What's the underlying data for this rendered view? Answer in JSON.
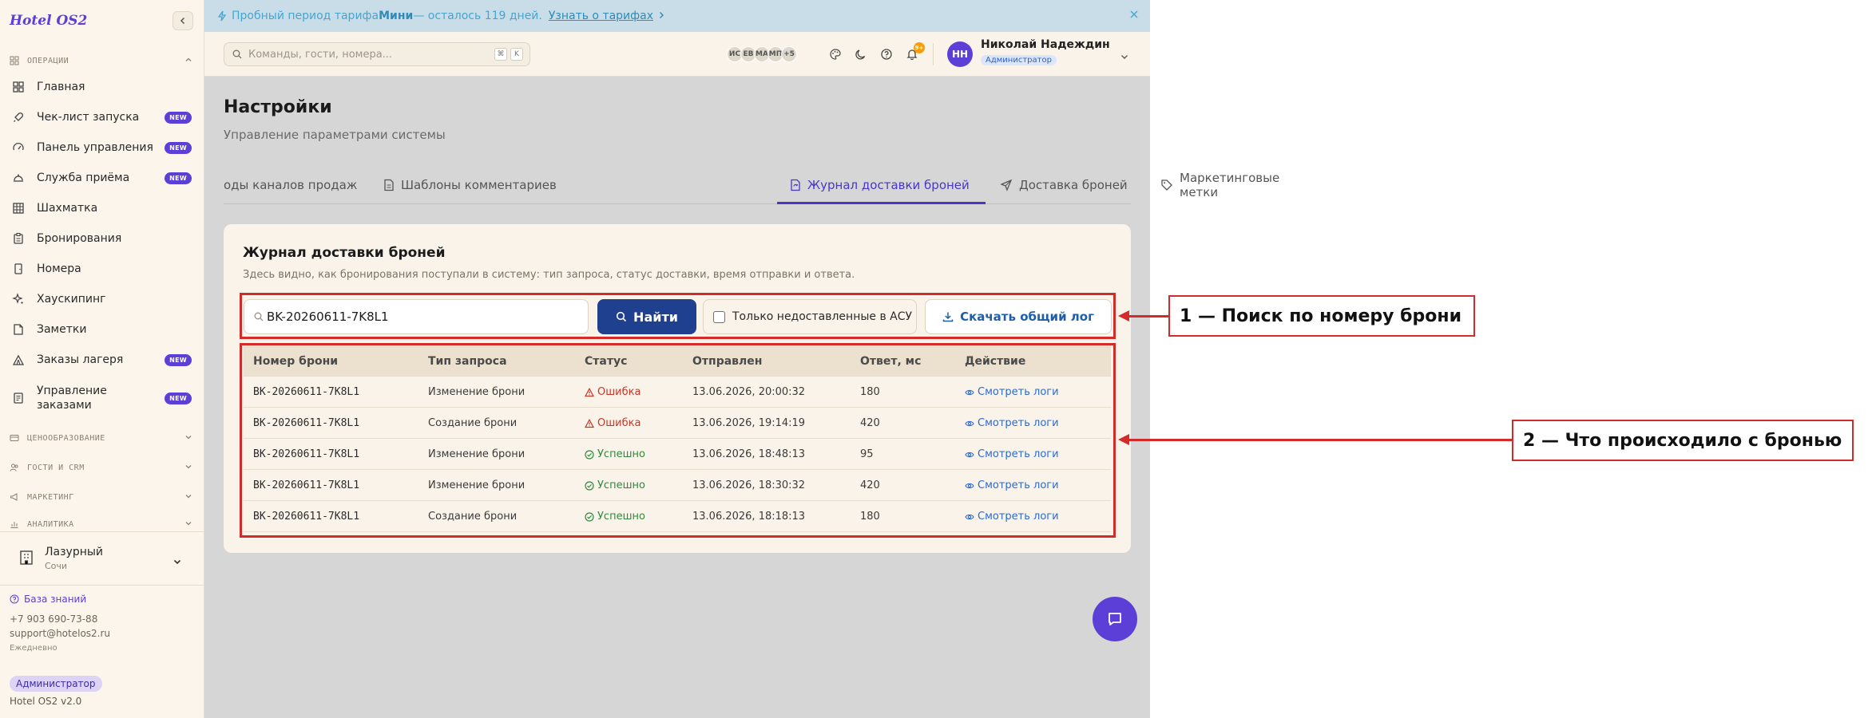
{
  "sidebar": {
    "brand": "Hotel OS2",
    "sections": {
      "operations": "ОПЕРАЦИИ",
      "pricing": "ЦЕНООБРАЗОВАНИЕ",
      "guests": "ГОСТИ И CRM",
      "marketing": "МАРКЕТИНГ",
      "analytics": "АНАЛИТИКА"
    },
    "items": [
      {
        "label": "Главная",
        "badge": ""
      },
      {
        "label": "Чек-лист запуска",
        "badge": "NEW"
      },
      {
        "label": "Панель управления",
        "badge": "NEW"
      },
      {
        "label": "Служба приёма",
        "badge": "NEW"
      },
      {
        "label": "Шахматка",
        "badge": ""
      },
      {
        "label": "Бронирования",
        "badge": ""
      },
      {
        "label": "Номера",
        "badge": ""
      },
      {
        "label": "Хаускипинг",
        "badge": ""
      },
      {
        "label": "Заметки",
        "badge": ""
      },
      {
        "label": "Заказы лагеря",
        "badge": "NEW"
      },
      {
        "label": "Управление заказами",
        "badge": "NEW"
      }
    ],
    "hotel": {
      "name": "Лазурный",
      "city": "Сочи"
    },
    "footer": {
      "kb_label": "База знаний",
      "phone": "+7 903 690-73-88",
      "email": "support@hotelos2.ru",
      "schedule": "Ежедневно",
      "role": "Администратор",
      "version": "Hotel OS2 v2.0"
    }
  },
  "trial_banner": {
    "prefix": "Пробный период тарифа ",
    "plan": "Мини",
    "suffix": " — осталось 119 дней.",
    "link": "Узнать о тарифах"
  },
  "header": {
    "search_placeholder": "Команды, гости, номера...",
    "shortcut_keys": [
      "⌘",
      "K"
    ],
    "avatars": [
      "ИС",
      "ЕВ",
      "МА",
      "МП",
      "+5"
    ],
    "notifications": "9+",
    "user": {
      "initials": "НН",
      "name": "Николай Надеждин",
      "role": "Администратор"
    }
  },
  "page": {
    "title": "Настройки",
    "subtitle": "Управление параметрами системы",
    "tabs": [
      "оды каналов продаж",
      "Шаблоны комментариев",
      "Журнал доставки броней",
      "Доставка броней",
      "Маркетинговые метки"
    ],
    "active_tab": 2
  },
  "card": {
    "title": "Журнал доставки броней",
    "subtitle": "Здесь видно, как бронирования поступали в систему: тип запроса, статус доставки, время отправки и ответа.",
    "search_value": "BK-20260611-7K8L1",
    "find_label": "Найти",
    "checkbox_label": "Только недоставленные в АСУ",
    "checkbox_checked": false,
    "download_label": "Скачать общий лог",
    "columns": [
      "Номер брони",
      "Тип запроса",
      "Статус",
      "Отправлен",
      "Ответ, мс",
      "Действие"
    ],
    "rows": [
      {
        "id": "BK-20260611-7K8L1",
        "type": "Изменение брони",
        "status": "Ошибка",
        "ok": false,
        "sent": "13.06.2026, 20:00:32",
        "ms": "180",
        "action": "Смотреть логи"
      },
      {
        "id": "BK-20260611-7K8L1",
        "type": "Создание брони",
        "status": "Ошибка",
        "ok": false,
        "sent": "13.06.2026, 19:14:19",
        "ms": "420",
        "action": "Смотреть логи"
      },
      {
        "id": "BK-20260611-7K8L1",
        "type": "Изменение брони",
        "status": "Успешно",
        "ok": true,
        "sent": "13.06.2026, 18:48:13",
        "ms": "95",
        "action": "Смотреть логи"
      },
      {
        "id": "BK-20260611-7K8L1",
        "type": "Изменение брони",
        "status": "Успешно",
        "ok": true,
        "sent": "13.06.2026, 18:30:32",
        "ms": "420",
        "action": "Смотреть логи"
      },
      {
        "id": "BK-20260611-7K8L1",
        "type": "Создание брони",
        "status": "Успешно",
        "ok": true,
        "sent": "13.06.2026, 18:18:13",
        "ms": "180",
        "action": "Смотреть логи"
      }
    ]
  },
  "annotations": [
    "1 — Поиск по номеру брони",
    "2 — Что происходило с бронью"
  ],
  "colors": {
    "accent": "#5b3fd6",
    "primary_button": "#1f3f8f",
    "error": "#c2382b",
    "success": "#2e8a3d",
    "annotation": "#d32a2a"
  }
}
